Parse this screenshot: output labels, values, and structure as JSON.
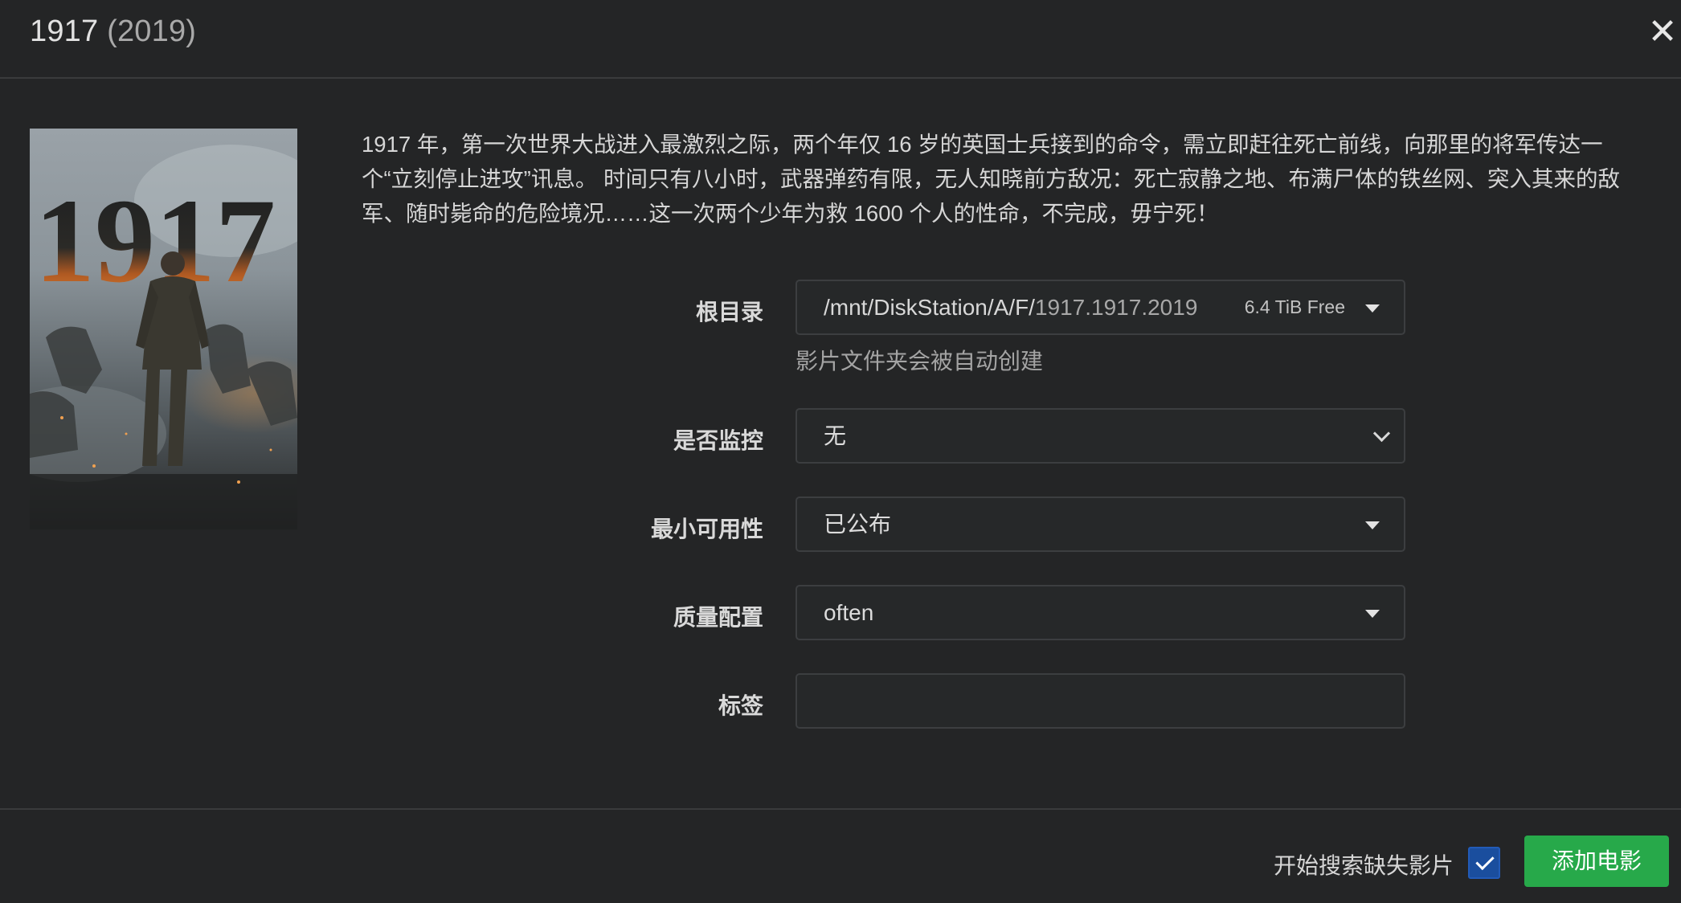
{
  "header": {
    "title": "1917",
    "year": "(2019)"
  },
  "movie": {
    "overview": "1917 年，第一次世界大战进入最激烈之际，两个年仅 16 岁的英国士兵接到的命令，需立即赶往死亡前线，向那里的将军传达一个“立刻停止进攻”讯息。 时间只有八小时，武器弹药有限，无人知晓前方敌况：死亡寂静之地、布满尸体的铁丝网、突入其来的敌军、随时毙命的危险境况……这一次两个少年为救 1600 个人的性命，不完成，毋宁死！",
    "poster_text": "1917"
  },
  "form": {
    "root_folder": {
      "label": "根目录",
      "path_base": "/mnt/DiskStation/A/F/",
      "path_folder": "1917.1917.2019",
      "free_space": "6.4 TiB Free",
      "help": "影片文件夹会被自动创建"
    },
    "monitor": {
      "label": "是否监控",
      "value": "无"
    },
    "minimum_availability": {
      "label": "最小可用性",
      "value": "已公布"
    },
    "quality_profile": {
      "label": "质量配置",
      "value": "often"
    },
    "tags": {
      "label": "标签",
      "value": ""
    }
  },
  "footer": {
    "search_label": "开始搜索缺失影片",
    "search_checked": true,
    "add_button": "添加电影"
  },
  "colors": {
    "background": "#242526",
    "accent_green": "#27a94a",
    "checkbox_blue": "#1a4e9e"
  }
}
